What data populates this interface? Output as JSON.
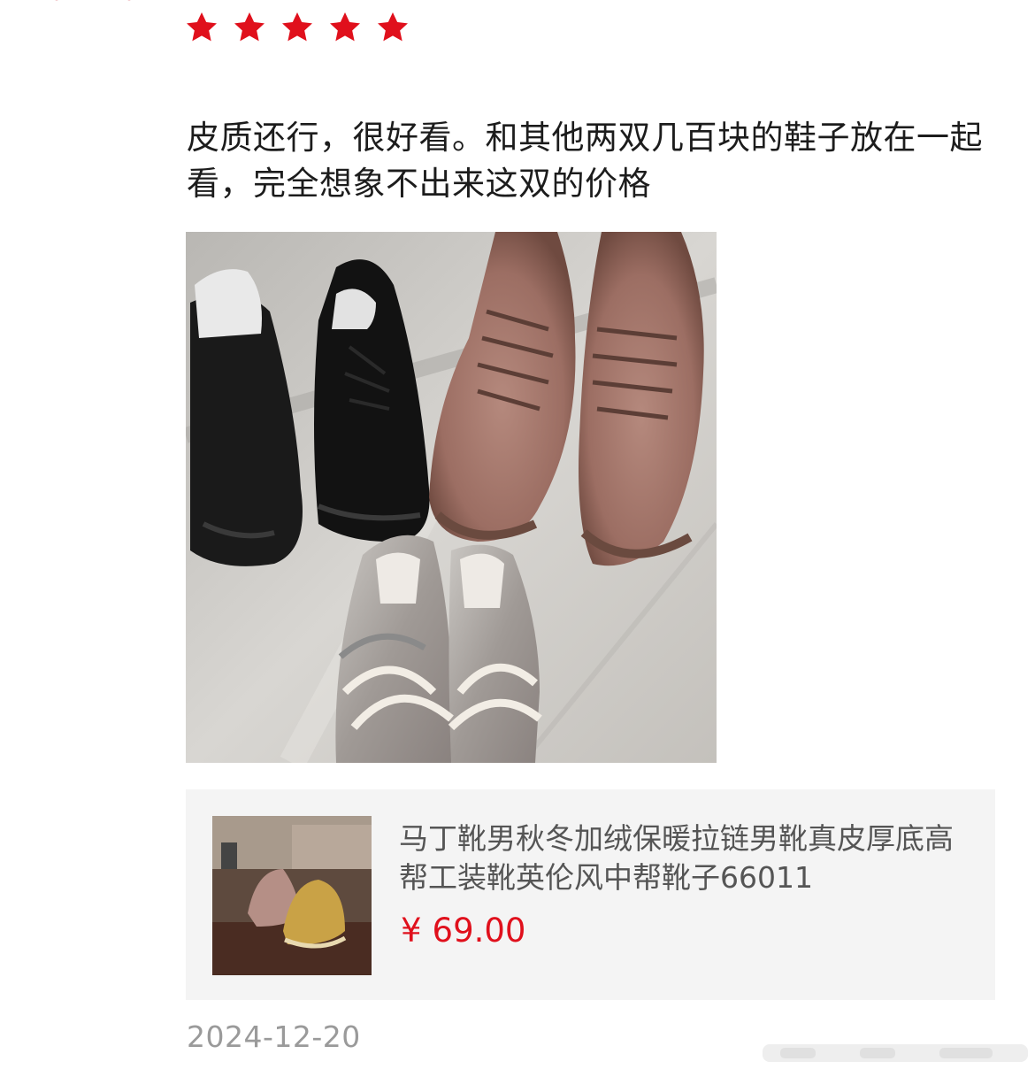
{
  "review": {
    "rating": 5,
    "rating_max": 5,
    "star_color": "#e0101c",
    "comment": "皮质还行，很好看。和其他两双几百块的鞋子放在一起看，完全想象不出来这双的价格",
    "date": "2024-12-20"
  },
  "product": {
    "title": "马丁靴男秋冬加绒保暖拉链男靴真皮厚底高帮工装靴英伦风中帮靴子66011",
    "price_symbol": "¥",
    "price_value": "69.00",
    "price_color": "#e0101c"
  },
  "icons": {
    "star": "star-icon",
    "photo": "review-photo",
    "thumb": "product-thumbnail"
  }
}
